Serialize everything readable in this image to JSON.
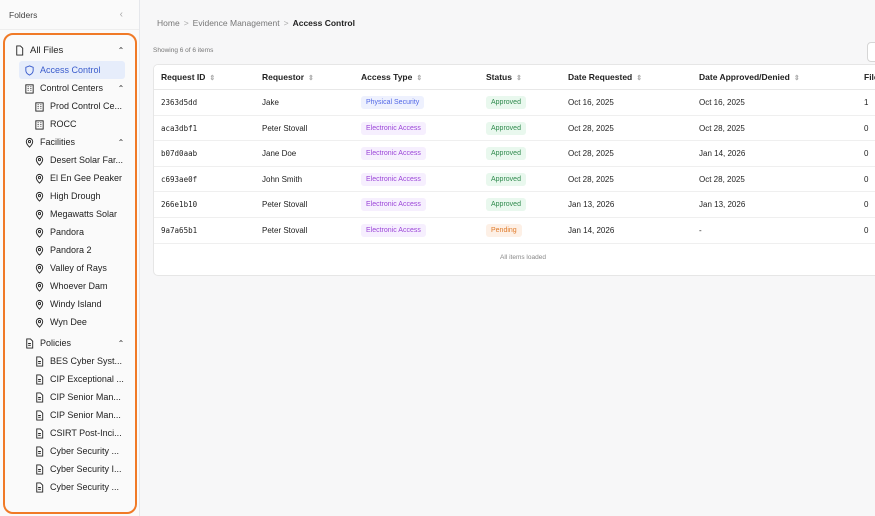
{
  "sidebar": {
    "header": "Folders",
    "all_files": "All Files",
    "access_control": "Access Control",
    "control_centers": {
      "label": "Control Centers",
      "items": [
        "Prod Control Ce...",
        "ROCC"
      ]
    },
    "facilities": {
      "label": "Facilities",
      "items": [
        "Desert Solar Far...",
        "El En Gee Peaker",
        "High Drough",
        "Megawatts Solar",
        "Pandora",
        "Pandora 2",
        "Valley of Rays",
        "Whoever Dam",
        "Windy Island",
        "Wyn Dee"
      ]
    },
    "policies": {
      "label": "Policies",
      "items": [
        "BES Cyber Syst...",
        "CIP Exceptional ...",
        "CIP Senior Man...",
        "CIP Senior Man...",
        "CSIRT Post-Inci...",
        "Cyber Security ...",
        "Cyber Security I...",
        "Cyber Security ..."
      ]
    }
  },
  "breadcrumb": {
    "home": "Home",
    "sep": ">",
    "section": "Evidence Management",
    "current": "Access Control"
  },
  "showing": "Showing 6 of 6 items",
  "table": {
    "columns": [
      "Request ID",
      "Requestor",
      "Access Type",
      "Status",
      "Date Requested",
      "Date Approved/Denied",
      "File"
    ],
    "rows": [
      {
        "id": "2363d5dd",
        "requestor": "Jake",
        "type": "Physical Security",
        "status": "Approved",
        "requested": "Oct 16, 2025",
        "decided": "Oct 16, 2025",
        "files": "1"
      },
      {
        "id": "aca3dbf1",
        "requestor": "Peter Stovall",
        "type": "Electronic Access",
        "status": "Approved",
        "requested": "Oct 28, 2025",
        "decided": "Oct 28, 2025",
        "files": "0"
      },
      {
        "id": "b07d0aab",
        "requestor": "Jane Doe",
        "type": "Electronic Access",
        "status": "Approved",
        "requested": "Oct 28, 2025",
        "decided": "Jan 14, 2026",
        "files": "0"
      },
      {
        "id": "c693ae0f",
        "requestor": "John Smith",
        "type": "Electronic Access",
        "status": "Approved",
        "requested": "Oct 28, 2025",
        "decided": "Oct 28, 2025",
        "files": "0"
      },
      {
        "id": "266e1b10",
        "requestor": "Peter Stovall",
        "type": "Electronic Access",
        "status": "Approved",
        "requested": "Jan 13, 2026",
        "decided": "Jan 13, 2026",
        "files": "0"
      },
      {
        "id": "9a7a65b1",
        "requestor": "Peter Stovall",
        "type": "Electronic Access",
        "status": "Pending",
        "requested": "Jan 14, 2026",
        "decided": "-",
        "files": "0"
      }
    ],
    "footer": "All items loaded"
  },
  "colors": {
    "accent": "#3a5ccc",
    "highlight_frame": "#f07a27",
    "approved": "#2f8a4d",
    "pending": "#e07b2a",
    "physical": "#5167e6",
    "electronic": "#9b45d8"
  }
}
